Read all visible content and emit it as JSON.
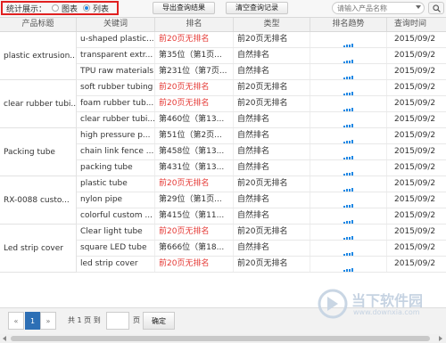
{
  "toolbar": {
    "stat_label": "统计展示：",
    "option_chart": "图表",
    "option_list": "列表",
    "selected": "list",
    "export_btn": "导出查询结果",
    "clear_btn": "清空查询记录",
    "search_placeholder": "请输入产品名称"
  },
  "table": {
    "headers": [
      "产品标题",
      "关键词",
      "排名",
      "类型",
      "排名趋势",
      "查询时间"
    ],
    "groups": [
      {
        "title": "plastic extrusion...",
        "rows": [
          {
            "keyword": "u-shaped plastic...",
            "rank": "前20页无排名",
            "rank_red": true,
            "type": "前20页无排名",
            "time": "2015/09/2"
          },
          {
            "keyword": "transparent extr...",
            "rank": "第35位（第1页...",
            "rank_red": false,
            "type": "自然排名",
            "time": "2015/09/2"
          },
          {
            "keyword": "TPU raw materials",
            "rank": "第231位（第7页...",
            "rank_red": false,
            "type": "自然排名",
            "time": "2015/09/2"
          }
        ]
      },
      {
        "title": "clear rubber tubi...",
        "rows": [
          {
            "keyword": "soft rubber tubing",
            "rank": "前20页无排名",
            "rank_red": true,
            "type": "前20页无排名",
            "time": "2015/09/2"
          },
          {
            "keyword": "foam rubber tub...",
            "rank": "前20页无排名",
            "rank_red": true,
            "type": "前20页无排名",
            "time": "2015/09/2"
          },
          {
            "keyword": "clear rubber tubi...",
            "rank": "第460位（第13...",
            "rank_red": false,
            "type": "自然排名",
            "time": "2015/09/2"
          }
        ]
      },
      {
        "title": "Packing tube",
        "rows": [
          {
            "keyword": "high pressure p...",
            "rank": "第51位（第2页...",
            "rank_red": false,
            "type": "自然排名",
            "time": "2015/09/2"
          },
          {
            "keyword": "chain link fence ...",
            "rank": "第458位（第13...",
            "rank_red": false,
            "type": "自然排名",
            "time": "2015/09/2"
          },
          {
            "keyword": "packing tube",
            "rank": "第431位（第13...",
            "rank_red": false,
            "type": "自然排名",
            "time": "2015/09/2"
          }
        ]
      },
      {
        "title": "RX-0088 custo...",
        "rows": [
          {
            "keyword": "plastic tube",
            "rank": "前20页无排名",
            "rank_red": true,
            "type": "前20页无排名",
            "time": "2015/09/2"
          },
          {
            "keyword": "nylon pipe",
            "rank": "第29位（第1页...",
            "rank_red": false,
            "type": "自然排名",
            "time": "2015/09/2"
          },
          {
            "keyword": "colorful custom ...",
            "rank": "第415位（第11...",
            "rank_red": false,
            "type": "自然排名",
            "time": "2015/09/2"
          }
        ]
      },
      {
        "title": "Led strip cover",
        "rows": [
          {
            "keyword": "Clear light tube",
            "rank": "前20页无排名",
            "rank_red": true,
            "type": "前20页无排名",
            "time": "2015/09/2"
          },
          {
            "keyword": "square LED tube",
            "rank": "第666位（第18...",
            "rank_red": false,
            "type": "自然排名",
            "time": "2015/09/2"
          },
          {
            "keyword": "led strip cover",
            "rank": "前20页无排名",
            "rank_red": true,
            "type": "前20页无排名",
            "time": "2015/09/2"
          }
        ]
      }
    ]
  },
  "pager": {
    "prev": "«",
    "current": "1",
    "next": "»",
    "total_text": "共 1 页 到",
    "page_unit": "页",
    "confirm": "确定"
  },
  "watermark": {
    "brand": "当下软件园",
    "url": "www.downxia.com"
  },
  "colors": {
    "accent": "#2d6fb5",
    "rank_red": "#e53935",
    "trend_blue": "#1e88e5",
    "highlight_border": "#e02020"
  }
}
